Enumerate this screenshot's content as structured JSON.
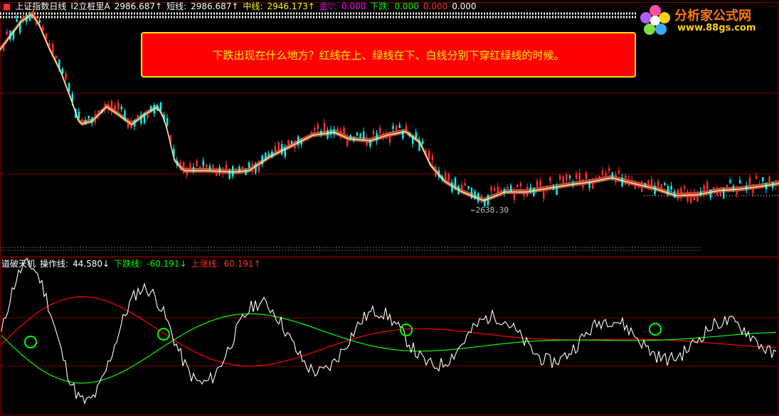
{
  "top_header": {
    "title": "上证指数日线",
    "indicator": "I2立桩里A",
    "value1": "2986.687↑",
    "short_label": "短线:",
    "short_value": "2986.687↑",
    "mid_label": "中线:",
    "mid_value": "2946.173↑",
    "gold_label": "金▽:",
    "gold_value": "0.000",
    "down_label": "下跌:",
    "down_value": "0.000",
    "extra1": "0.000",
    "extra2": "0.000"
  },
  "callout": {
    "text": "下跌出现在什么地方？红线在上、绿线在下、白线分别下穿红绿线的时候。"
  },
  "logo": {
    "name": "分析家公式网",
    "url": "www.88gs.com"
  },
  "price_low_label": "←2638.30",
  "lower_header": {
    "title": "道破天机",
    "op_label": "操作线:",
    "op_value": "44.580↓",
    "down_label": "下跌线:",
    "down_value": "-60.191↓",
    "up_label": "上涨线:",
    "up_value": "60.191↑"
  },
  "colors": {
    "bg": "#000000",
    "up_candle": "#ff3030",
    "down_candle": "#00ffff",
    "ma_line": "#ffff99",
    "band_fill": "#c8604a",
    "grid": "#7a0000",
    "op_line": "#ffffff",
    "down_line": "#00ff00",
    "up_line": "#ff0000",
    "marker": "#00ff00"
  },
  "icons": [
    "flower-logo-icon",
    "circle-marker-icon"
  ]
}
